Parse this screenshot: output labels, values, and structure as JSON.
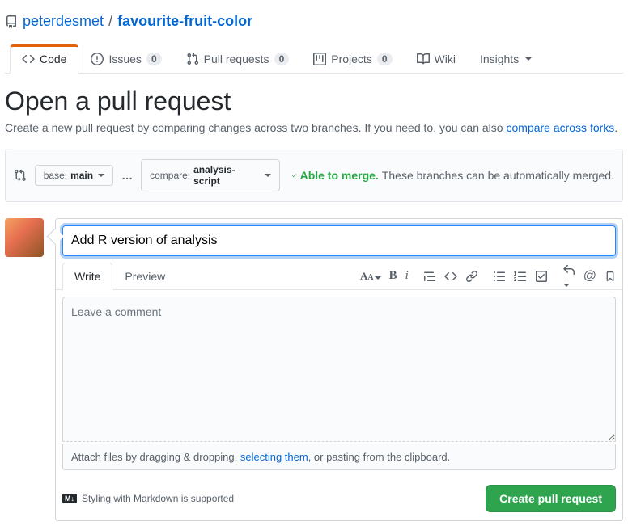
{
  "repo": {
    "owner": "peterdesmet",
    "name": "favourite-fruit-color",
    "separator": "/"
  },
  "tabs": {
    "code": "Code",
    "issues": "Issues",
    "issues_count": "0",
    "pulls": "Pull requests",
    "pulls_count": "0",
    "projects": "Projects",
    "projects_count": "0",
    "wiki": "Wiki",
    "insights": "Insights"
  },
  "page": {
    "title": "Open a pull request",
    "subtitle_pre": "Create a new pull request by comparing changes across two branches. If you need to, you can also ",
    "subtitle_link": "compare across forks",
    "subtitle_post": "."
  },
  "compare": {
    "base_label": "base: ",
    "base_branch": "main",
    "dots": "…",
    "compare_label": "compare: ",
    "compare_branch": "analysis-script",
    "able_label": "Able to merge.",
    "detail": "These branches can be automatically merged."
  },
  "form": {
    "title_value": "Add R version of analysis",
    "write_tab": "Write",
    "preview_tab": "Preview",
    "comment_placeholder": "Leave a comment",
    "attach_pre": "Attach files by dragging & dropping, ",
    "attach_link": "selecting them",
    "attach_post": ", or pasting from the clipboard.",
    "md_badge": "M↓",
    "md_hint": "Styling with Markdown is supported",
    "submit": "Create pull request"
  }
}
